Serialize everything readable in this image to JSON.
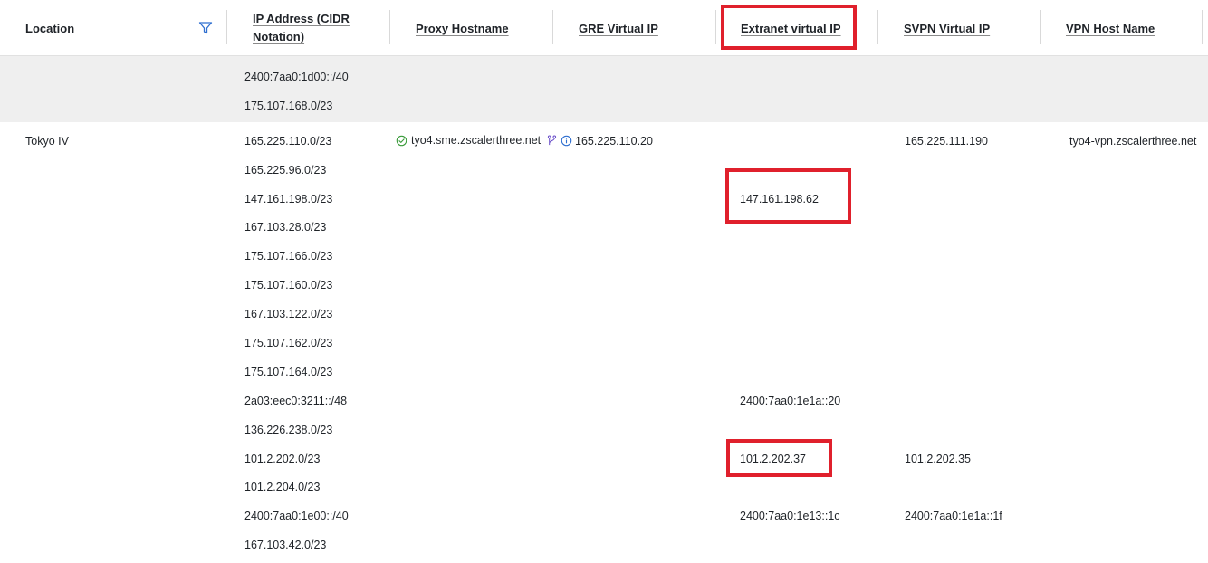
{
  "colors": {
    "accent": "#2f6fd0",
    "highlight": "#e0202c",
    "ok": "#3a9b3a",
    "band": "#efefef"
  },
  "header": {
    "location": "Location",
    "ip_line1": "IP Address (CIDR",
    "ip_line2": "Notation)",
    "proxy": "Proxy Hostname",
    "gre": "GRE Virtual IP",
    "extranet": "Extranet virtual IP",
    "svpn": "SVPN Virtual IP",
    "vpn": "VPN Host Name",
    "filter_icon": "filter-icon"
  },
  "prev_row": {
    "ips": [
      "2400:7aa0:1d00::/40",
      "175.107.168.0/23"
    ]
  },
  "row": {
    "location": "Tokyo IV",
    "proxy_hostname": "tyo4.sme.zscalerthree.net",
    "proxy_status_icon": "check-circle-icon",
    "proxy_branch_icon": "branch-icon",
    "proxy_info_icon": "info-icon",
    "gre_ip": "165.225.110.20",
    "svpn_ip_1": "165.225.111.190",
    "vpn_host": "tyo4-vpn.zscalerthree.net",
    "extranet_1": "147.161.198.62",
    "extranet_2": "2400:7aa0:1e1a::20",
    "extranet_3": "101.2.202.37",
    "extranet_4": "2400:7aa0:1e13::1c",
    "svpn_ip_2": "101.2.202.35",
    "svpn_ip_3": "2400:7aa0:1e1a::1f",
    "ips": [
      "165.225.110.0/23",
      "165.225.96.0/23",
      "147.161.198.0/23",
      "167.103.28.0/23",
      "175.107.166.0/23",
      "175.107.160.0/23",
      "167.103.122.0/23",
      "175.107.162.0/23",
      "175.107.164.0/23",
      "2a03:eec0:3211::/48",
      "136.226.238.0/23",
      "101.2.202.0/23",
      "101.2.204.0/23",
      "2400:7aa0:1e00::/40",
      "167.103.42.0/23"
    ]
  }
}
